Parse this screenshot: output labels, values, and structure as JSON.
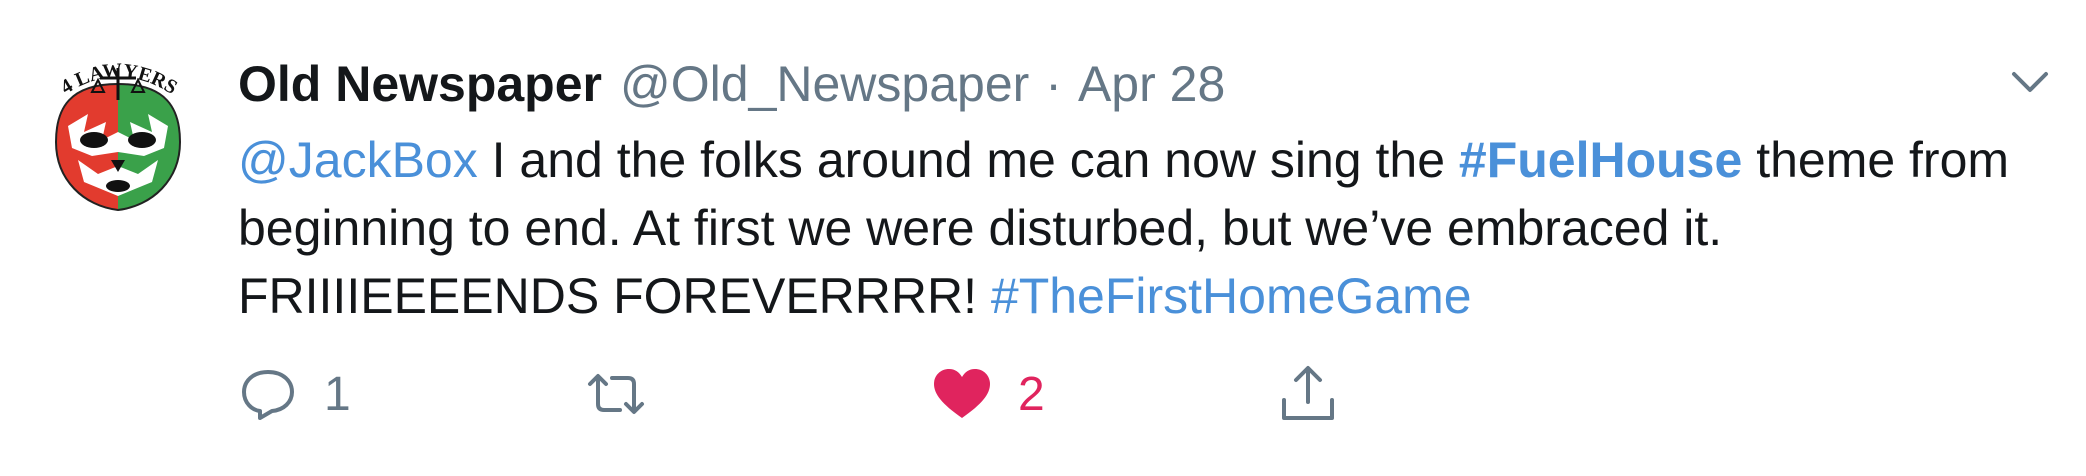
{
  "tweet": {
    "author_name": "Old Newspaper",
    "author_handle": "@Old_Newspaper",
    "separator": "·",
    "date": "Apr 28",
    "avatar_text": "4 LAWYERS",
    "text": {
      "mention": "@JackBox",
      "part1": " I and the folks around me can now sing the ",
      "hashtag1": "#FuelHouse",
      "part2": " theme from",
      "line2": "beginning to end. At first we were disturbed, but we’ve embraced it.",
      "line3_text": "FRIIIIEEEENDS FOREVERRRR! ",
      "hashtag2": "#TheFirstHomeGame"
    },
    "actions": {
      "reply_count": "1",
      "retweet_count": "",
      "like_count": "2"
    }
  },
  "colors": {
    "link": "#4a90d9",
    "like": "#e0245e",
    "muted": "#657786",
    "text": "#14171a"
  },
  "icons": {
    "reply": "reply-icon",
    "retweet": "retweet-icon",
    "like": "heart-icon",
    "share": "share-icon",
    "menu": "chevron-down-icon"
  }
}
